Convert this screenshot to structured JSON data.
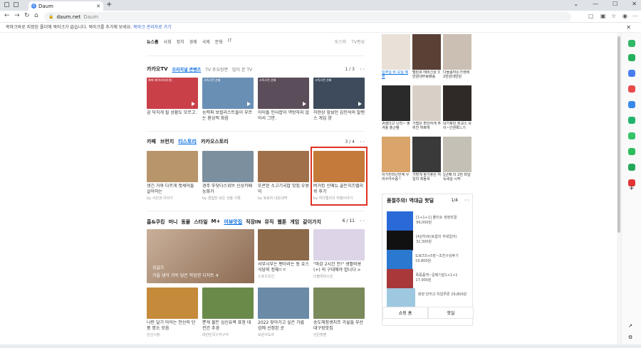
{
  "browser": {
    "tab_title": "Daum",
    "address": "daum.net",
    "address_site": "Daum"
  },
  "bookmark_bar": {
    "text": "북마크바로 지정된 폴더에 북마크가 없습니다. 북마크를 추가해 보세요.",
    "link": "북마크 관리자로 가기"
  },
  "news_bar": {
    "items": [
      "뉴스홈",
      "사회",
      "정치",
      "경제",
      "국제",
      "문화",
      "IT"
    ],
    "right": [
      "포스퍼",
      "TV편성"
    ]
  },
  "kakaotv": {
    "title": "카카오TV",
    "tabs": [
      "오리지널 콘텐츠",
      "TV 주요장면",
      "많이 본 TV"
    ],
    "page": "1 / 3",
    "cards": [
      {
        "tag": "최애 캐릭터(버추얼)",
        "title": "곰 닥치게 될 상황도 모르고.",
        "color": "#c94048"
      },
      {
        "tag": "고독스런 선배",
        "title": "능력파 보컬리스트들이 부르는 환상적 화음",
        "color": "#6a8fb5"
      },
      {
        "tag": "고독스런 선배",
        "title": "아이돌 인사합이 역방하지 않아서 그만.",
        "color": "#5c4d5a"
      },
      {
        "tag": "고독스런 선배",
        "title": "하현상 앞뒀던 김민석의 발렌스 게임 양",
        "color": "#3d4b5c"
      }
    ]
  },
  "cafe": {
    "title": "카페",
    "tabs": [
      "브런치",
      "티스토리",
      "카카오스토리"
    ],
    "page": "3 / 4",
    "cards": [
      {
        "title": "생긴 거와 다르게 캣세어들 살아하는",
        "src": "by 사진과 이야기",
        "color": "#b8956a"
      },
      {
        "title": "경주 뚜닷다스위브 신상카페 능화가",
        "src": "by 경험한 모든 것들 기록",
        "color": "#7c8f9e"
      },
      {
        "title": "또콘된 소고기국밥 맛집 우용이",
        "src": "by 호로지 내돈내먹",
        "color": "#a0704a"
      },
      {
        "title": "버거킹 신메뉴 골든치즈렐리쉬 후기",
        "src": "by 히다렐리의 여행이야기",
        "color": "#c47a3a"
      }
    ]
  },
  "section3": {
    "tabs": [
      "홈&쿠킹",
      "머니",
      "동물",
      "스타일",
      "M+",
      "어뷰맛집",
      "직장IN",
      "뮤직",
      "웹툰",
      "게임",
      "같이가치"
    ],
    "selected": "어뷰맛집",
    "page": "6 / 11",
    "big_caption": "가을 냉각 가득 담은 작업한 디저트 4",
    "big_tag": "싱글즈",
    "side": [
      {
        "title": "서부시부는 팬이라는 통 호스 식당외 정체ㄷㄷ",
        "src": "스포츠조선",
        "color": "#8c6a4a"
      },
      {
        "title": "\"마감 2시간 전!\" 생활비용 (+) 의 구대해야 합니다 >",
        "src": "더블류비스킨",
        "color": "#ddd4e8"
      }
    ],
    "bottom": [
      {
        "title": "나란 달기 아이는 안산의 단풍 명소 모음",
        "src": "안산시청",
        "color": "#c58a3a"
      },
      {
        "title": "뿐게 불든 심신유목 표정 대전간 추경",
        "src": "대한민국구석구석",
        "color": "#6a8a4a"
      },
      {
        "title": "2022 찾아가고 싶은 가를 섬에 선정된 곳",
        "src": "보원사도라",
        "color": "#6a8aa8"
      },
      {
        "title": "송도해정생지프 가을들 부산대구장맛집",
        "src": "안은장팬",
        "color": "#7a8a5a"
      }
    ]
  },
  "shopping": {
    "products": [
      {
        "title": "일주일 비 오실 예정",
        "src": "",
        "color": "#e9e1d7"
      },
      {
        "title": "멜린흐 테비신상 3만원대무료배송",
        "color": "#5a4035"
      },
      {
        "title": "다들송하는가생배 2만원대만원",
        "color": "#cbbfb3"
      },
      {
        "title": "귀염다고 난리~ 좋겨울 출근템",
        "color": "#2a2a2a"
      },
      {
        "title": "가볍은 편안하게 주위진 여쁘게",
        "color": "#d8d0c6"
      },
      {
        "title": "내가찾던 최교스 유이~인덴룩느기",
        "color": "#2f2a28"
      },
      {
        "title": "이거진라난반계 우리수아수음 !",
        "color": "#d9a56a"
      },
      {
        "title": "가방게 좋기좋은 여일리 최들꼭",
        "color": "#3a3a3a"
      },
      {
        "title": "1년째 더 2번 퍼일득세실 시작",
        "color": "#c5c0b5"
      }
    ]
  },
  "deals": {
    "title": "품절주의! 역대급 핫딜",
    "page": "1/4",
    "items": [
      {
        "title": "[1+1+1] 물티슈 생정되결 99,000원",
        "color": "#2a6ad8"
      },
      {
        "title": "[4]/하)트(토합의 추워입어) 32,300원",
        "color": "#111"
      },
      {
        "title": "도로즈5+5장~초친구성후기 19,800원",
        "color": "#2b78d0"
      },
      {
        "title": "폭풍품백~갈매기살1+1+1 17,900원",
        "color": "#a8383a"
      },
      {
        "title": "화장 만히고 히알루론 29,800원",
        "color": "#9ec8e0"
      }
    ],
    "tabs": [
      "쇼핑 홈",
      "핫딜"
    ]
  }
}
